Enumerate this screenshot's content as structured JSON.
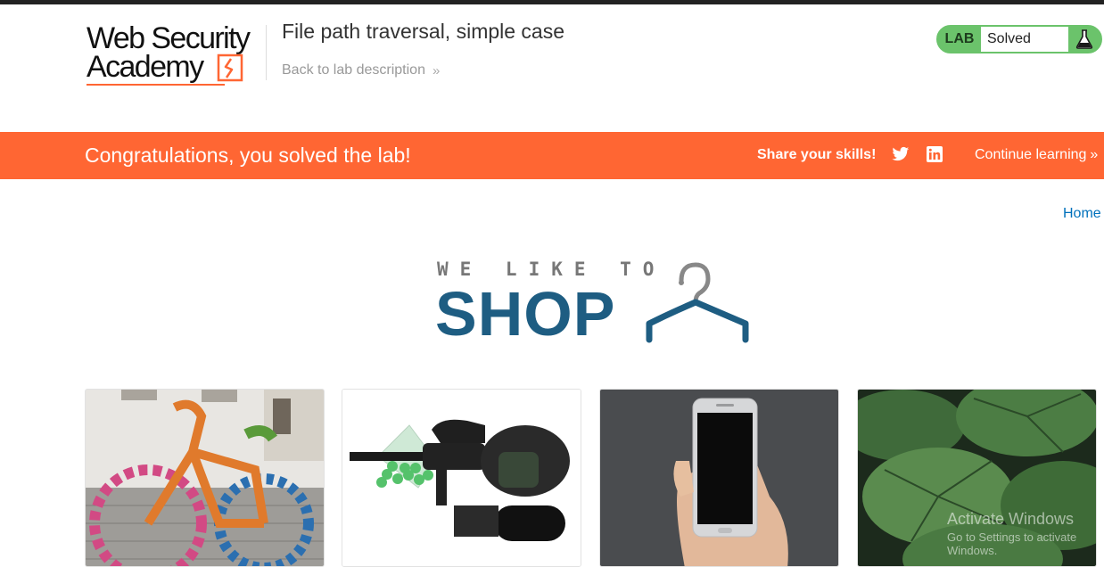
{
  "header": {
    "logo_line1": "Web Security",
    "logo_line2": "Academy",
    "lab_title": "File path traversal, simple case",
    "back_link": "Back to lab description",
    "status_prefix": "LAB",
    "status": "Solved",
    "accent_color": "#ff6633",
    "status_color": "#6bc36b"
  },
  "banner": {
    "message": "Congratulations, you solved the lab!",
    "share": "Share your skills!",
    "continue": "Continue learning",
    "icons": [
      "twitter-icon",
      "linkedin-icon"
    ]
  },
  "nav": {
    "home": "Home"
  },
  "shop_logo": {
    "tagline": "WE LIKE TO",
    "word": "SHOP",
    "color": "#1e5d82"
  },
  "products": [
    {
      "image": "knitted bicycle"
    },
    {
      "image": "paintball gun and mask"
    },
    {
      "image": "smartphone in hand"
    },
    {
      "image": "green leaves"
    }
  ],
  "watermark": {
    "line1": "Activate Windows",
    "line2": "Go to Settings to activate Windows."
  }
}
